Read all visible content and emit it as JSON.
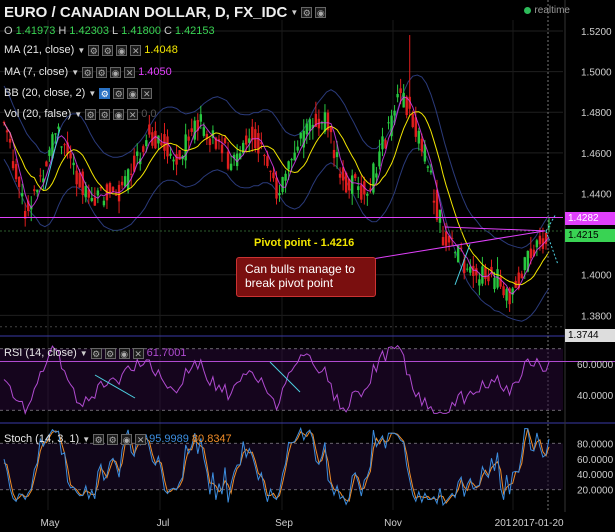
{
  "header": {
    "title": "EURO / CANADIAN DOLLAR, D, FX_IDC",
    "realtime": "realtime",
    "ohlc": {
      "o_label": "O",
      "o": "1.41973",
      "h_label": "H",
      "h": "1.42303",
      "l_label": "L",
      "l": "1.41800",
      "c_label": "C",
      "c": "1.42153"
    }
  },
  "indicators": {
    "ma21": {
      "label": "MA (21, close)",
      "value": "1.4048",
      "color": "#f2e600"
    },
    "ma7": {
      "label": "MA (7, close)",
      "value": "1.4050",
      "color": "#e040fb"
    },
    "bb": {
      "label": "BB (20, close, 2)"
    },
    "vol": {
      "label": "Vol (20, false)",
      "value": "0  0"
    },
    "rsi": {
      "label": "RSI (14, close)",
      "value": "61.7001",
      "color": "#b04bd0"
    },
    "stoch": {
      "label": "Stoch (14, 3, 1)",
      "k": "95.9989",
      "d": "80.8347",
      "k_color": "#3c8dde",
      "d_color": "#f08c28"
    }
  },
  "price_axis": {
    "ticks": [
      "1.5200",
      "1.5000",
      "1.4800",
      "1.4600",
      "1.4400",
      "1.4000",
      "1.3800"
    ],
    "pivot_tag": "1.4282",
    "last_tag": "1.4215",
    "low_tag": "1.3744",
    "pivot_color": "#e040fb",
    "last_color": "#39d353"
  },
  "rsi_axis": {
    "ticks": [
      "60.0000",
      "40.0000"
    ]
  },
  "stoch_axis": {
    "ticks": [
      "80.0000",
      "60.0000",
      "40.0000",
      "20.0000"
    ]
  },
  "time_axis": {
    "labels": [
      "May",
      "Jul",
      "Sep",
      "Nov",
      "201",
      "2017-01-20"
    ]
  },
  "annotations": {
    "pivot_text": "Pivot point - 1.4216",
    "callout": "Can bulls manage to break pivot point"
  },
  "colors": {
    "up": "#28c840",
    "down": "#e01e1e",
    "bg": "#000000"
  }
}
